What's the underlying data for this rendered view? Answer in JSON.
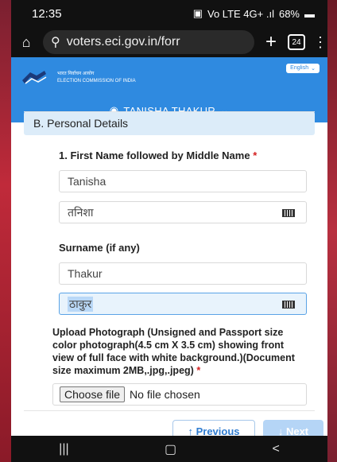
{
  "status": {
    "time": "12:35",
    "battery": "68%",
    "signal": "Vo LTE 4G+ .ıl"
  },
  "browser": {
    "url": "voters.eci.gov.in/forr",
    "tab_count": "24"
  },
  "header": {
    "org_hindi": "भारत निर्वाचन आयोग",
    "org_english": "ELECTION COMMISSION OF INDIA",
    "language": "English",
    "user_name": "TANISHA THAKUR"
  },
  "section": {
    "title": "B. Personal Details"
  },
  "form": {
    "first_name_label": "1. First Name followed by Middle Name",
    "required_mark": "*",
    "first_name_value": "Tanisha",
    "first_name_hindi": "तनिशा",
    "surname_label": "Surname (if any)",
    "surname_value": "Thakur",
    "surname_hindi": "ठाकुर",
    "upload_label": "Upload Photograph (Unsigned and Passport size color photograph(4.5 cm X 3.5 cm) showing front view of full face with white background.)(Document size maximum 2MB,.jpg,.jpeg)",
    "choose_file": "Choose file",
    "no_file": "No file chosen"
  },
  "buttons": {
    "previous": "↑ Previous",
    "next": "↓ Next"
  },
  "colors": {
    "header_blue": "#2f8ae0",
    "section_bg": "#dcecf9",
    "required": "#d42020"
  }
}
